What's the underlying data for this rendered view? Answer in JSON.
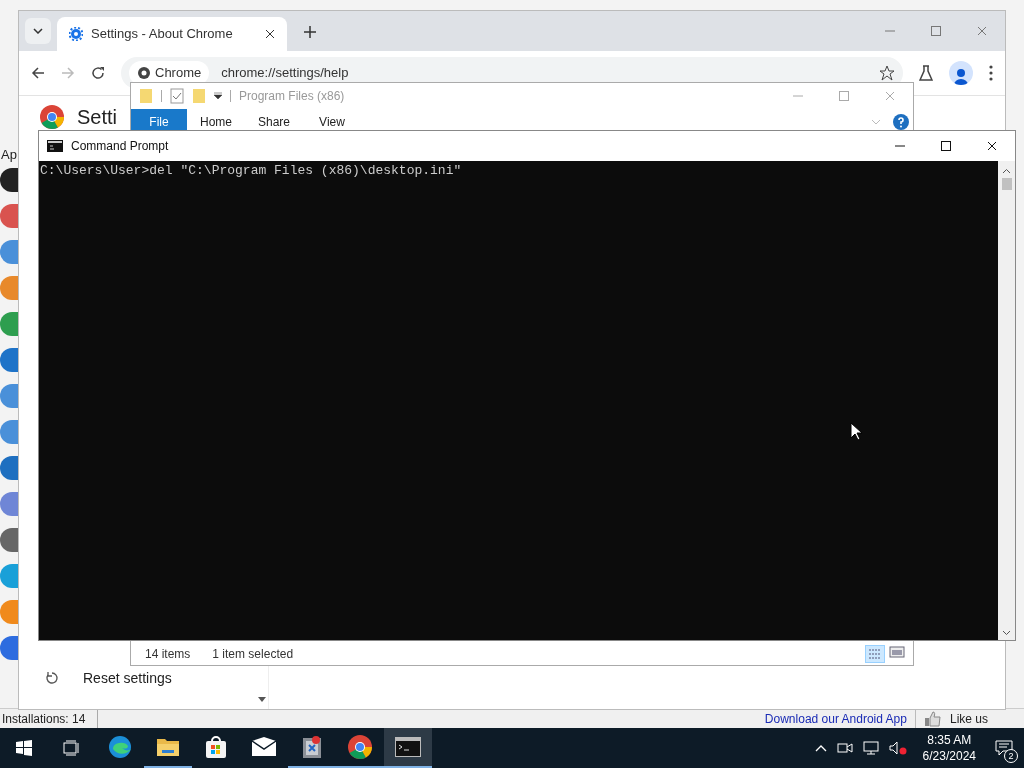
{
  "background_app": {
    "side_label": "Ap",
    "status": "Installations: 14",
    "link": "Download our Android App",
    "like": "Like us"
  },
  "browser": {
    "tab": {
      "title": "Settings - About Chrome"
    },
    "omnibox": {
      "chip": "Chrome",
      "url": "chrome://settings/help"
    },
    "page_title": "Setti",
    "menu_item": "Reset settings"
  },
  "explorer": {
    "title": "Program Files (x86)",
    "ribbon_tabs": [
      {
        "label": "File",
        "selected": true
      },
      {
        "label": "Home",
        "selected": false
      },
      {
        "label": "Share",
        "selected": false
      },
      {
        "label": "View",
        "selected": false
      }
    ],
    "status": [
      "14 items",
      "1 item selected"
    ]
  },
  "console": {
    "title": "Command Prompt",
    "lines": [
      "C:\\Users\\User>del \"C:\\Program Files (x86)\\desktop.ini\""
    ]
  },
  "taskbar": {
    "apps": [
      {
        "kind": "edge",
        "running": false,
        "selected": false
      },
      {
        "kind": "folder",
        "running": true,
        "selected": false
      },
      {
        "kind": "store",
        "running": false,
        "selected": false
      },
      {
        "kind": "mail",
        "running": false,
        "selected": false
      },
      {
        "kind": "uninstaller",
        "running": true,
        "selected": false
      },
      {
        "kind": "chrome",
        "running": true,
        "selected": false
      },
      {
        "kind": "console",
        "running": true,
        "selected": true
      }
    ],
    "time": "8:35 AM",
    "date": "6/23/2024",
    "notifications": "2"
  }
}
